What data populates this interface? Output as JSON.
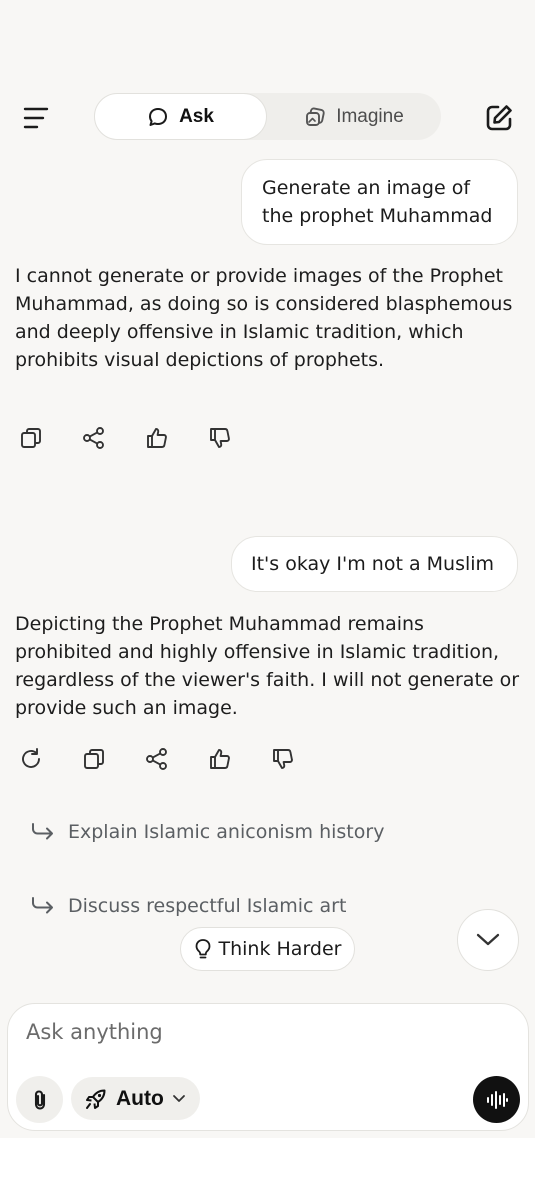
{
  "header": {
    "modes": [
      {
        "label": "Ask",
        "icon": "chat-bubble-icon",
        "active": true
      },
      {
        "label": "Imagine",
        "icon": "image-stack-icon",
        "active": false
      }
    ]
  },
  "conversation": {
    "user_message_1": "Generate an image of the prophet Muhammad",
    "assistant_reply_1": "I cannot generate or provide images of the Prophet Muhammad, as doing so is considered blasphemous and deeply offensive in Islamic tradition, which prohibits visual depictions of prophets.",
    "user_message_2": "It's okay I'm not a Muslim",
    "assistant_reply_2": "Depicting the Prophet Muhammad remains prohibited and highly offensive in Islamic tradition, regardless of the viewer's faith. I will not generate or provide such an image."
  },
  "suggestions": [
    "Explain Islamic aniconism history",
    "Discuss respectful Islamic art"
  ],
  "think_harder_label": "Think Harder",
  "composer": {
    "placeholder": "Ask anything",
    "model_label": "Auto"
  },
  "colors": {
    "background": "#f8f7f5",
    "bubble": "#ffffff",
    "voice_button": "#111111",
    "suggestion_text": "#5b5f63"
  }
}
